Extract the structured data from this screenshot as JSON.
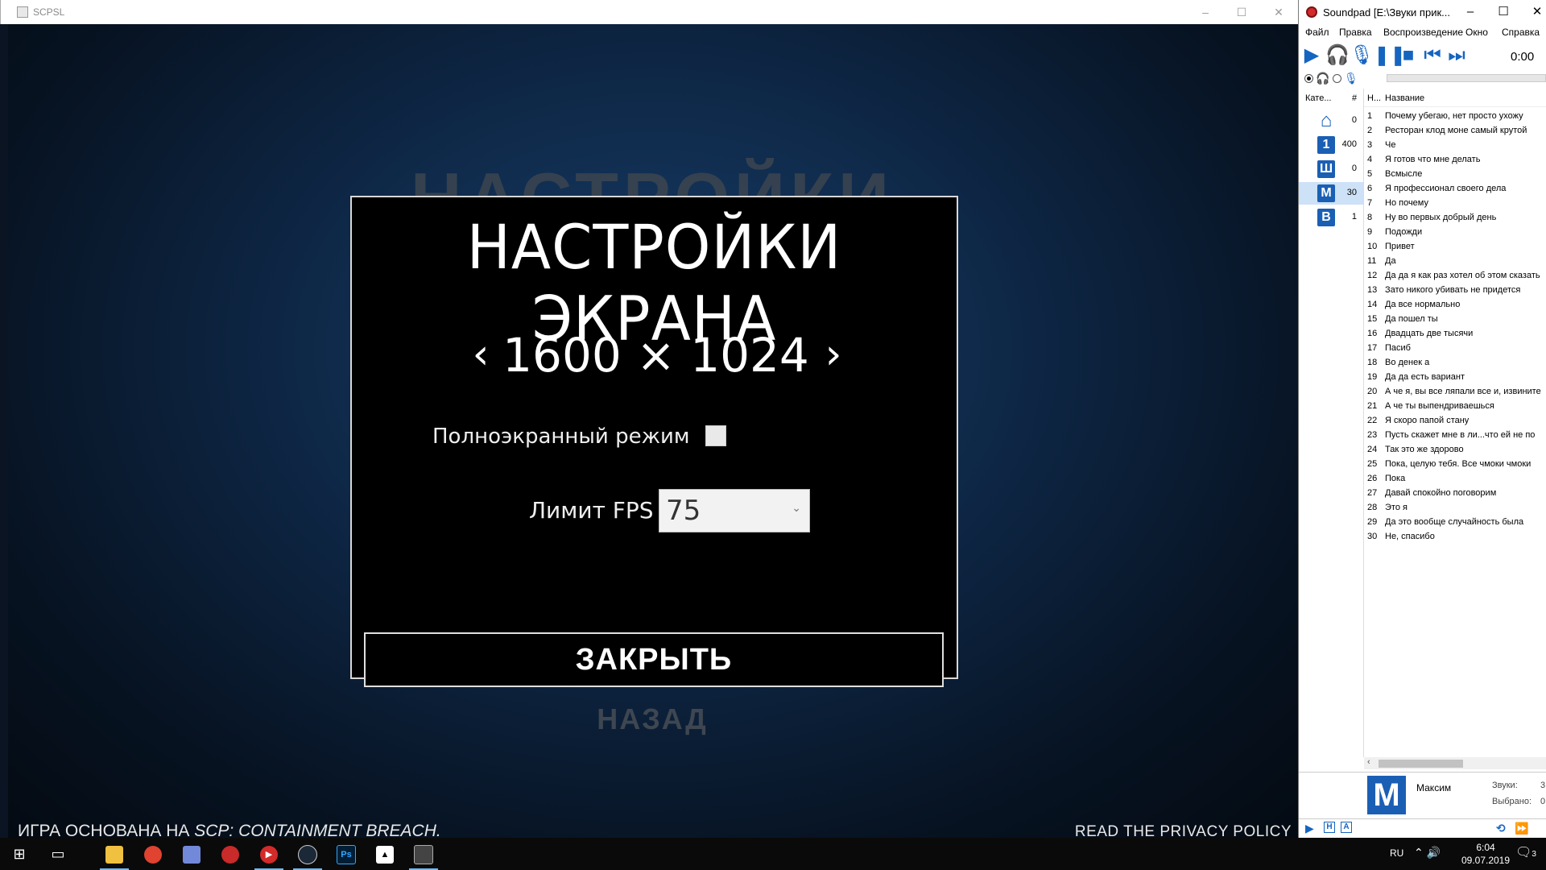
{
  "game_window": {
    "title": "SCPSL",
    "bg_title": "НАСТРОЙКИ",
    "bg_back": "НАЗАД",
    "dialog": {
      "title": "НАСТРОЙКИ ЭКРАНА",
      "resolution": "1600 × 1024",
      "prev_glyph": "‹",
      "next_glyph": "›",
      "fullscreen_label": "Полноэкранный режим",
      "fullscreen_checked": false,
      "fps_label": "Лимит FPS",
      "fps_value": "75",
      "close_label": "ЗАКРЫТЬ"
    },
    "footer_left_prefix": "ИГРА ОСНОВАНА НА ",
    "footer_left_emph": "SCP: CONTAINMENT BREACH.",
    "footer_right": "READ THE PRIVACY POLICY"
  },
  "soundpad": {
    "title": "Soundpad [E:\\Звуки прик...",
    "menu": [
      "Файл",
      "Правка",
      "Воспроизведение",
      "Окно",
      "Справка"
    ],
    "time": "0:00",
    "cat_header": {
      "name": "Кате...",
      "count": "#"
    },
    "categories": [
      {
        "icon": "⌂",
        "label": "",
        "count": "0"
      },
      {
        "icon": "",
        "label": "1",
        "count": "400"
      },
      {
        "icon": "",
        "label": "Ш",
        "count": "0"
      },
      {
        "icon": "",
        "label": "М",
        "count": "30"
      },
      {
        "icon": "",
        "label": "В",
        "count": "1"
      }
    ],
    "list_header": {
      "num": "Н...",
      "name": "Название"
    },
    "sounds": [
      "Почему убегаю, нет просто ухожу",
      "Ресторан клод моне самый крутой",
      "Че",
      "Я готов что мне делать",
      "Всмысле",
      "Я профессионал своего дела",
      "Но почему",
      "Ну во первых добрый день",
      "Подожди",
      "Привет",
      "Да",
      "Да да я как раз хотел об этом сказать",
      "Зато никого убивать не придется",
      "Да все нормально",
      "Да пошел ты",
      "Двадцать две тысячи",
      "Пасиб",
      "Во денек а",
      "Да да есть вариант",
      "А че я, вы все ляпали все и, извините",
      "А че ты выпендриваешься",
      "Я скоро папой стану",
      "Пусть скажет мне в ли...что ей не по",
      "Так это же здорово",
      "Пока, целую тебя. Все чмоки чмоки",
      "Пока",
      "Давай спокойно поговорим",
      "Это я",
      "Да это вообще случайность была",
      "Не, спасибо"
    ],
    "info": {
      "icon_letter": "М",
      "name": "Максим",
      "sounds_label": "Звуки:",
      "sounds_value": "3",
      "selected_label": "Выбрано:",
      "selected_value": "0"
    },
    "bottom": {
      "h": "Н",
      "a": "А"
    }
  },
  "taskbar": {
    "lang": "RU",
    "time": "6:04",
    "date": "09.07.2019",
    "notif_count": "3",
    "ps_label": "Ps"
  }
}
